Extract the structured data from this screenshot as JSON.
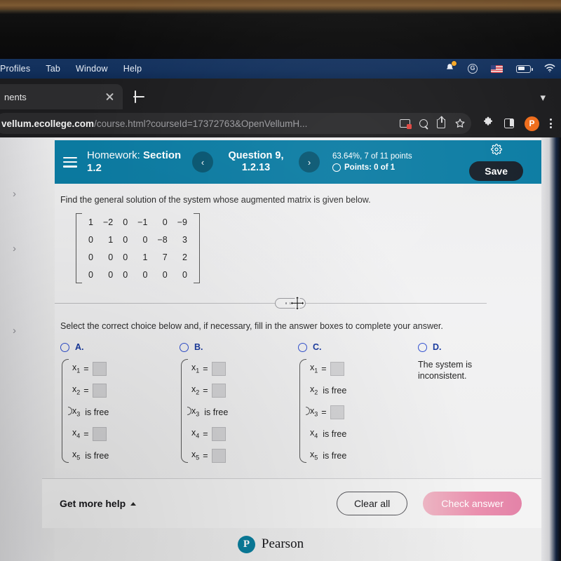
{
  "os_menubar": {
    "items": [
      "Profiles",
      "Tab",
      "Window",
      "Help"
    ],
    "status_icons": [
      "bell-icon",
      "grammarly-icon",
      "us-flag-icon",
      "battery-icon",
      "wifi-icon"
    ],
    "grammarly_letter": "G"
  },
  "browser": {
    "tab_title": "nents",
    "tab_close_icon": "close-icon",
    "new_tab_icon": "plus-icon",
    "tab_list_chevron": "chevron-down-icon",
    "url_host": "vellum.ecollege.com",
    "url_rest": "/course.html?courseId=17372763&OpenVellumH...",
    "omnibox_icons": [
      "cast-icon",
      "search-icon",
      "share-icon",
      "bookmark-star-icon"
    ],
    "toolbar_icons": [
      "extensions-puzzle-icon",
      "side-panel-icon",
      "profile-avatar",
      "menu-kebab-icon"
    ],
    "profile_initial": "P"
  },
  "gutter": {
    "chevrons": [
      "chevron-right-icon",
      "chevron-right-icon",
      "chevron-right-icon"
    ],
    "glyph": "›"
  },
  "question_header": {
    "menu_icon": "hamburger-icon",
    "title_prefix": "Homework: ",
    "title_bold": "Section 1.2",
    "prev_label": "‹",
    "next_label": "›",
    "question_label": "Question 9, 1.2.13",
    "score_line": "63.64%, 7 of 11 points",
    "points_label": "Points: 0 of 1",
    "settings_icon": "gear-icon",
    "save_label": "Save",
    "bg_color": "#0b7ca3",
    "save_bg": "#17202a"
  },
  "question": {
    "prompt": "Find the general solution of the system whose augmented matrix is given below.",
    "matrix": [
      [
        "1",
        "−2",
        "0",
        "−1",
        "0",
        "−9"
      ],
      [
        "0",
        "1",
        "0",
        "0",
        "−8",
        "3"
      ],
      [
        "0",
        "0",
        "0",
        "1",
        "7",
        "2"
      ],
      [
        "0",
        "0",
        "0",
        "0",
        "0",
        "0"
      ]
    ],
    "choice_prompt": "Select the correct choice below and, if necessary, fill in the answer boxes to complete your answer."
  },
  "divider": {
    "handle_icon": "drag-handle-dots",
    "cursor_icon": "move-cursor-icon"
  },
  "choices": [
    {
      "letter": "A.",
      "rows": [
        {
          "var": "x",
          "sub": "1",
          "type": "input"
        },
        {
          "var": "x",
          "sub": "2",
          "type": "input"
        },
        {
          "var": "x",
          "sub": "3",
          "type": "free",
          "text": "is free"
        },
        {
          "var": "x",
          "sub": "4",
          "type": "input"
        },
        {
          "var": "x",
          "sub": "5",
          "type": "free",
          "text": "is free"
        }
      ]
    },
    {
      "letter": "B.",
      "rows": [
        {
          "var": "x",
          "sub": "1",
          "type": "input"
        },
        {
          "var": "x",
          "sub": "2",
          "type": "input"
        },
        {
          "var": "x",
          "sub": "3",
          "type": "free",
          "text": "is free"
        },
        {
          "var": "x",
          "sub": "4",
          "type": "input"
        },
        {
          "var": "x",
          "sub": "5",
          "type": "input"
        }
      ]
    },
    {
      "letter": "C.",
      "rows": [
        {
          "var": "x",
          "sub": "1",
          "type": "input"
        },
        {
          "var": "x",
          "sub": "2",
          "type": "free",
          "text": "is free"
        },
        {
          "var": "x",
          "sub": "3",
          "type": "input"
        },
        {
          "var": "x",
          "sub": "4",
          "type": "free",
          "text": "is free"
        },
        {
          "var": "x",
          "sub": "5",
          "type": "free",
          "text": "is free"
        }
      ]
    },
    {
      "letter": "D.",
      "text": "The system is inconsistent."
    }
  ],
  "footer": {
    "get_more_help": "Get more help",
    "help_caret_icon": "caret-up-icon",
    "clear_all": "Clear all",
    "check_answer": "Check answer",
    "check_answer_color": "#e98fae"
  },
  "brand": {
    "logo_letter": "P",
    "name": "Pearson",
    "logo_color": "#0a7f9e"
  },
  "equals_sign": "="
}
